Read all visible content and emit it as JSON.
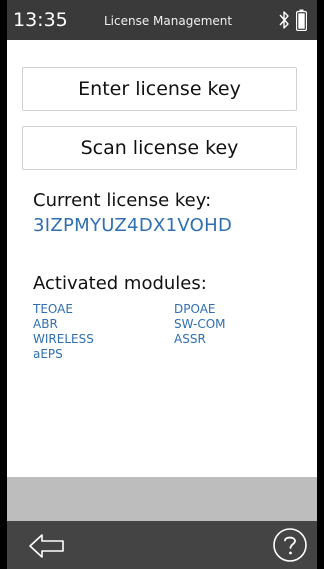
{
  "status_bar": {
    "time": "13:35",
    "title": "License Management",
    "icons": [
      "bluetooth-icon",
      "battery-icon"
    ]
  },
  "actions": {
    "enter_label": "Enter license key",
    "scan_label": "Scan license key"
  },
  "license": {
    "label": "Current license key:",
    "value": "3IZPMYUZ4DX1VOHD"
  },
  "modules": {
    "label": "Activated modules:",
    "items": [
      "TEOAE",
      "DPOAE",
      "ABR",
      "SW-COM",
      "WIRELESS",
      "ASSR",
      "aEPS"
    ]
  },
  "navigation": {
    "icons": [
      "back-icon",
      "help-icon"
    ]
  },
  "colors": {
    "status_bar": "#3a3a3a",
    "accent": "#2f6fb0",
    "footer": "#444444",
    "divider_band": "#bdbdbd"
  }
}
